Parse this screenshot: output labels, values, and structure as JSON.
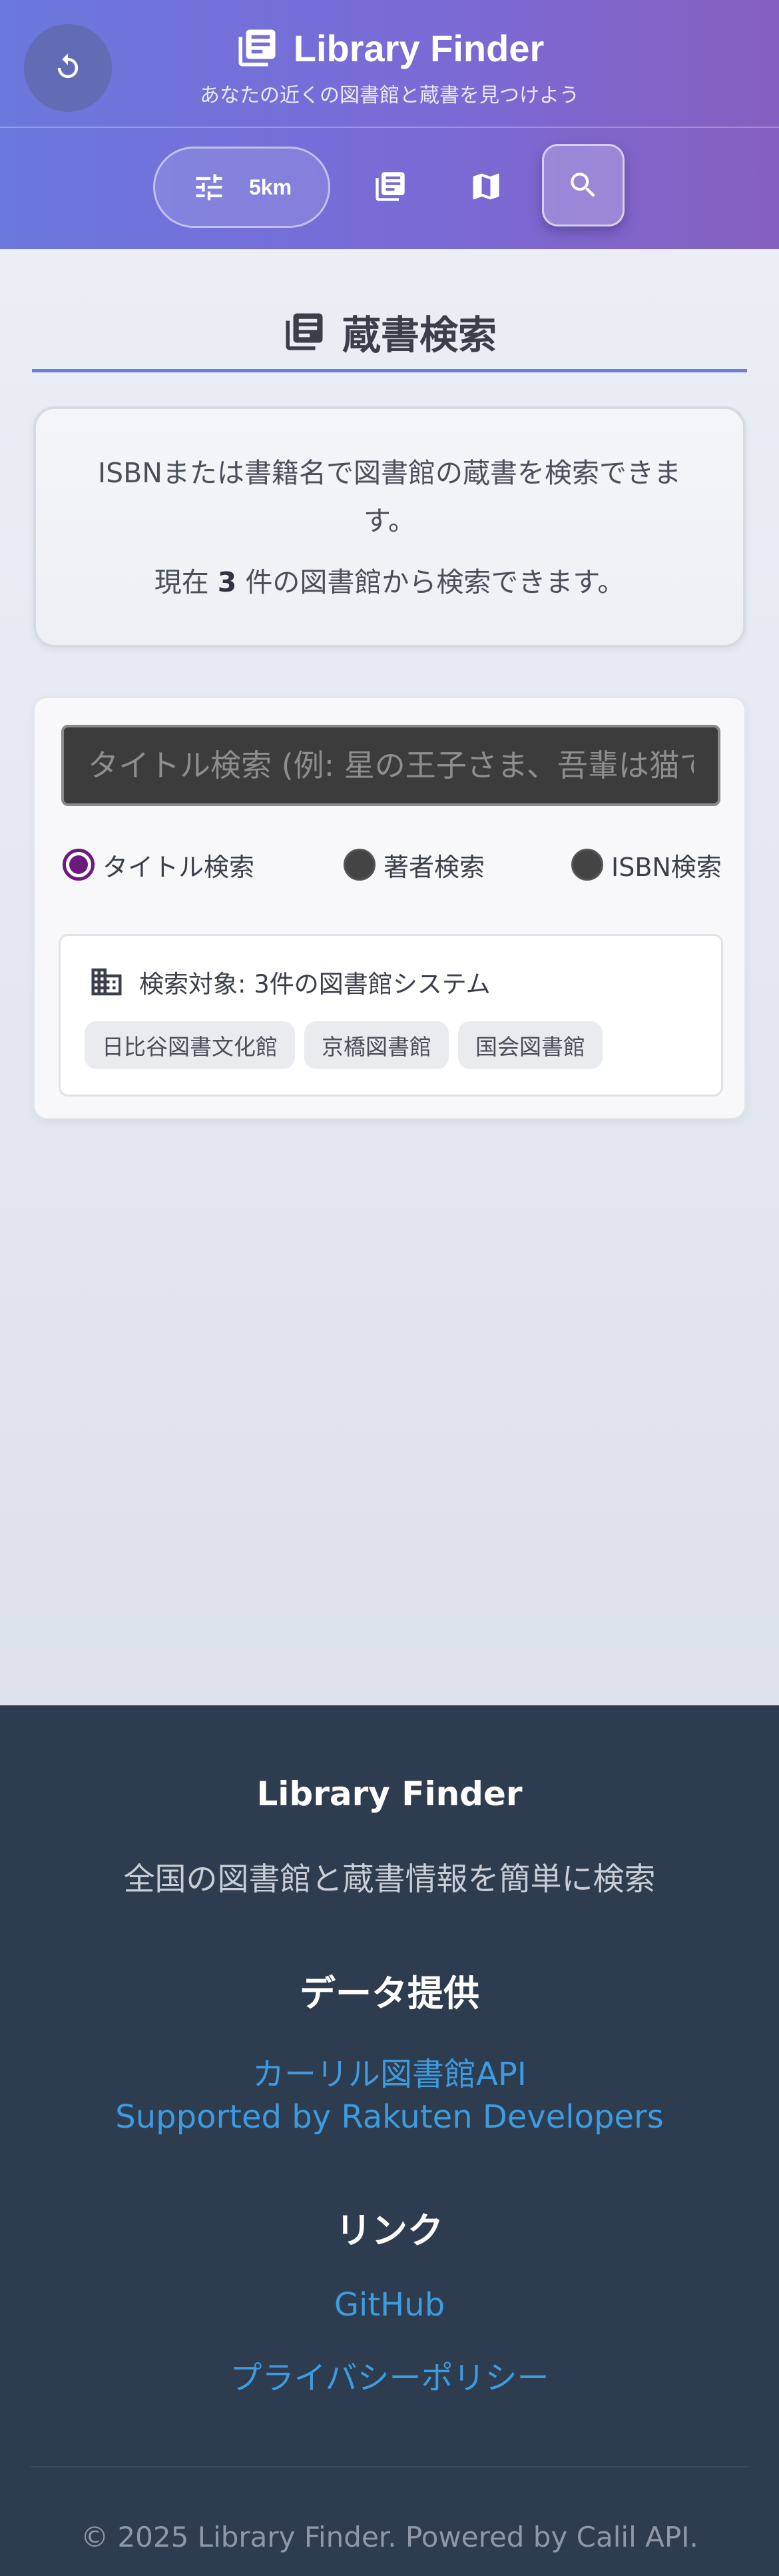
{
  "header": {
    "app_title": "Library Finder",
    "subtitle": "あなたの近くの図書館と蔵書を見つけよう",
    "radius_label": "5km"
  },
  "icons": {
    "refresh": "refresh-icon",
    "logo": "book-stack-icon",
    "filter": "sliders-icon",
    "library_list": "book-list-icon",
    "map": "map-icon",
    "search": "search-icon",
    "building": "building-icon"
  },
  "section": {
    "title": "蔵書検索"
  },
  "info": {
    "line1": "ISBNまたは書籍名で図書館の蔵書を検索できます。",
    "line2_prefix": "現在",
    "count": "3",
    "line2_suffix": "件の図書館から検索できます。"
  },
  "search": {
    "placeholder": "タイトル検索 (例: 星の王子さま、吾輩は猫である)",
    "value": "",
    "modes": [
      {
        "label": "タイトル検索",
        "checked": true
      },
      {
        "label": "著者検索",
        "checked": false
      },
      {
        "label": "ISBN検索",
        "checked": false
      }
    ],
    "target_label": "検索対象: 3件の図書館システム",
    "libraries": [
      "日比谷図書文化館",
      "京橋図書館",
      "国会図書館"
    ]
  },
  "footer": {
    "title": "Library Finder",
    "description": "全国の図書館と蔵書情報を簡単に検索",
    "data_heading": "データ提供",
    "data_links": [
      "カーリル図書館API",
      "Supported by Rakuten Developers"
    ],
    "links_heading": "リンク",
    "links": [
      "GitHub",
      "プライバシーポリシー"
    ],
    "copyright": "© 2025 Library Finder. Powered by Calil API."
  },
  "colors": {
    "header_start": "#6b78dc",
    "header_end": "#8660c0",
    "accent_rule": "#6a7fdc",
    "radio_checked": "#6a1b7c",
    "footer_bg": "#2d3c4e",
    "link": "#3d9be0"
  }
}
